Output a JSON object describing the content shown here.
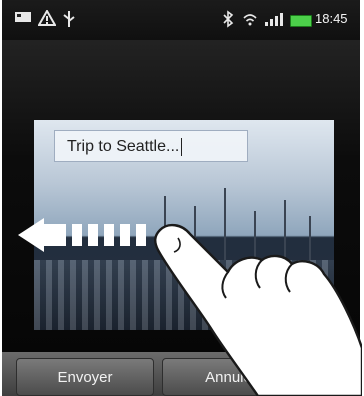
{
  "statusbar": {
    "time": "18:45",
    "icons": [
      "sd-card-icon",
      "warning-icon",
      "usb-icon",
      "bluetooth-icon",
      "wifi-icon",
      "signal-icon",
      "battery-icon"
    ]
  },
  "note": {
    "text": "Trip to Seattle..."
  },
  "buttons": {
    "send": "Envoyer",
    "cancel": "Annuler"
  },
  "colors": {
    "battery": "#4cd04a",
    "background": "#0c0c0c"
  }
}
